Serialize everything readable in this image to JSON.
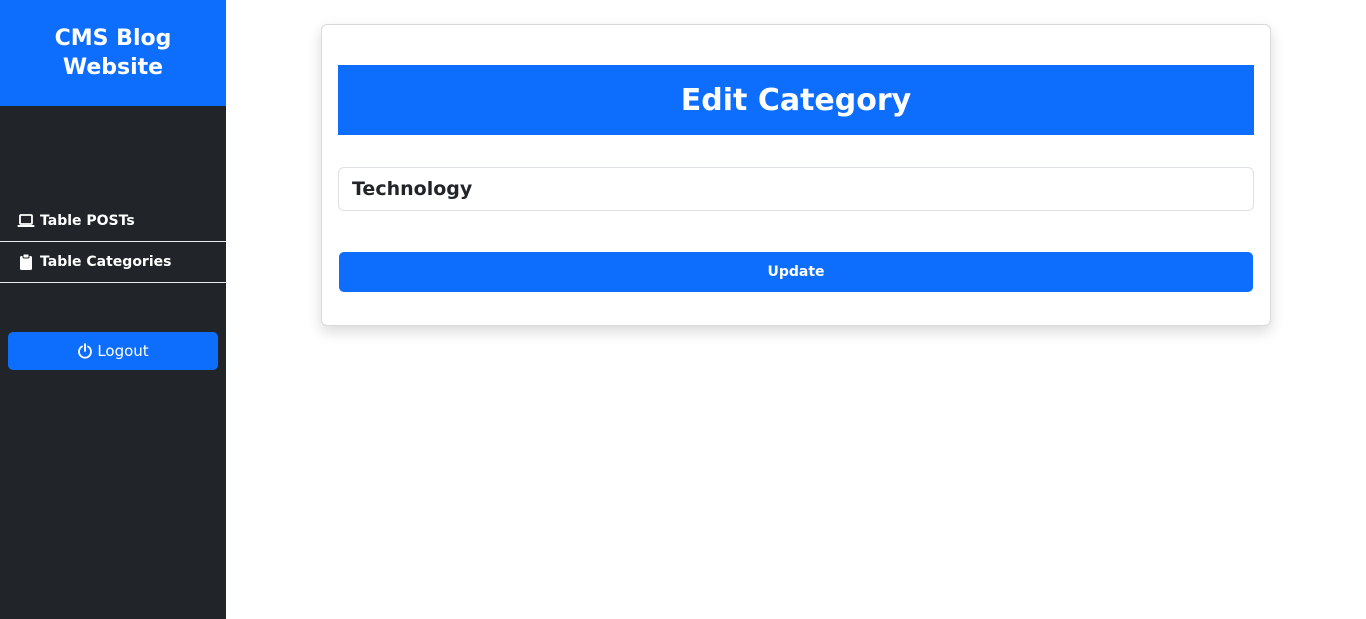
{
  "sidebar": {
    "brand": "CMS Blog Website",
    "items": [
      {
        "label": "Table POSTs",
        "icon": "laptop-icon"
      },
      {
        "label": "Table Categories",
        "icon": "clipboard-icon"
      }
    ],
    "logout_label": "Logout",
    "logout_icon": "power-icon"
  },
  "main": {
    "title": "Edit Category",
    "category_value": "Technology",
    "update_label": "Update"
  },
  "colors": {
    "primary": "#0d6efd",
    "sidebar_bg": "#212529"
  }
}
